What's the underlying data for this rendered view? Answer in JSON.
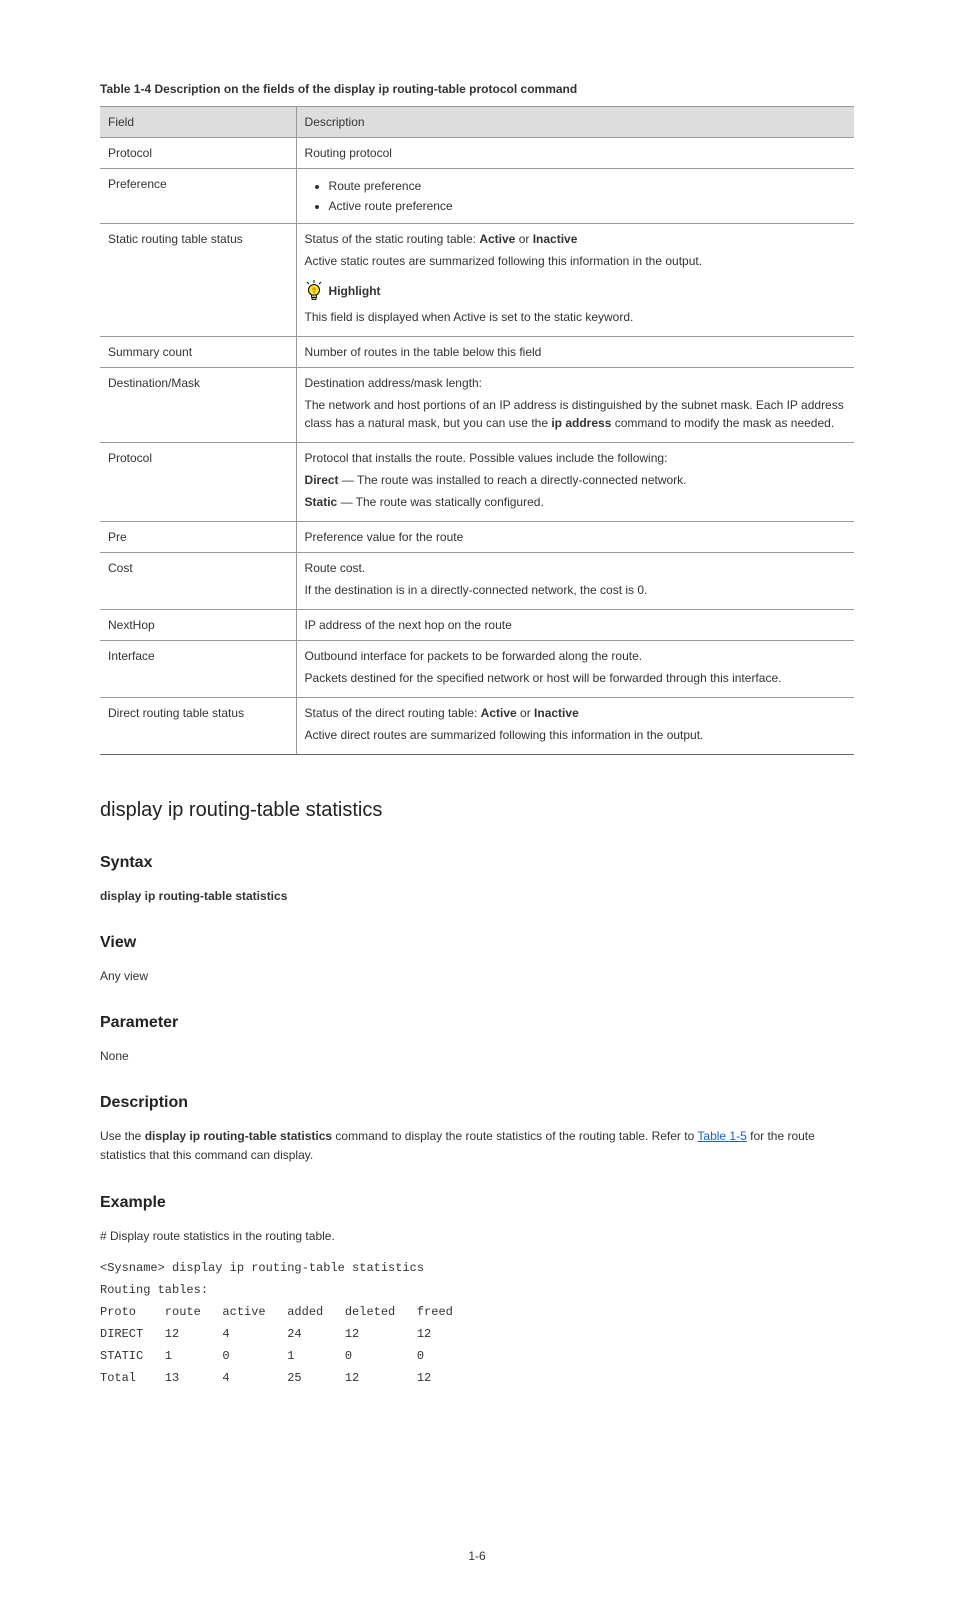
{
  "tableRef": "Table 1-4",
  "tableTitle": "Description on the fields of the",
  "tableTitleCommand": "display ip routing-table protocol",
  "tableTitleSuffix": " command",
  "headers": {
    "field": "Field",
    "description": "Description"
  },
  "rows": {
    "r1": {
      "field": "Protocol",
      "desc": "Routing protocol"
    },
    "r2": {
      "field": "Preference",
      "bullet1": "Route preference",
      "bullet2": "Active route preference"
    },
    "r3": {
      "field": "Static routing table status",
      "line1_a": "Status of the static routing table:",
      "line1_active": "Active",
      "line1_b": " or ",
      "line1_inactive": "Inactive",
      "line2": "Active static routes are summarized following this information in the output.",
      "highlight": "Highlight",
      "highlightText": "This field is displayed when Active is set to the static keyword."
    },
    "r4": {
      "field": "Summary count",
      "desc": "Number of routes in the table below this field"
    },
    "r5": {
      "field": "Destination/Mask",
      "p1": "Destination address/mask length:",
      "p2_a": "The network and host portions of an IP address is distinguished by the subnet mask. Each IP address class has a natural mask, but you can use the ",
      "p2_b": "ip address",
      "p2_c": " command to modify the mask as needed."
    },
    "r6": {
      "field": "Protocol",
      "p1": "Protocol that installs the route. Possible values include the following:",
      "p2_a": "Direct",
      "p2_b": " — The route was installed to reach a directly-connected network.",
      "p3_a": "Static",
      "p3_b": " — The route was statically configured."
    },
    "r7": {
      "field": "Pre",
      "desc": "Preference value for the route"
    },
    "r8": {
      "field": "Cost",
      "p1": "Route cost.",
      "p2": "If the destination is in a directly-connected network, the cost is 0."
    },
    "r9": {
      "field": "NextHop",
      "desc": "IP address of the next hop on the route"
    },
    "r10": {
      "field": "Interface",
      "p1": "Outbound interface for packets to be forwarded along the route.",
      "p2": "Packets destined for the specified network or host will be forwarded through this interface."
    },
    "r11": {
      "field": "Direct routing table status",
      "p1_a": "Status of the direct routing table:",
      "p1_active": "Active",
      "p1_b": " or ",
      "p1_inactive": "Inactive",
      "p2": "Active direct routes are summarized following this information in the output."
    }
  },
  "section1": {
    "title": "display ip routing-table statistics",
    "syntaxLabel": "Syntax",
    "syntaxCmd": "display ip routing-table statistics",
    "viewLabel": "View",
    "viewText": "Any view",
    "paramsLabel": "Parameter",
    "paramsText": "None",
    "descLabel": "Description",
    "desc_a": "Use the ",
    "desc_b": "display ip routing-table statistics",
    "desc_c": " command to display the route statistics of the routing table. Refer to ",
    "desc_link": "Table 1-5",
    "desc_d": " for the route statistics that this command can display."
  },
  "section2": {
    "title": "Example",
    "intro": "# Display route statistics in the routing table.",
    "cmd1_prompt": "<Sysname> ",
    "cmd1": "display ip routing-table statistics",
    "line2": "Routing tables:",
    "line3": "Proto    route   active   added   deleted   freed",
    "line4": "DIRECT   12      4        24      12        12",
    "line5": "STATIC   1       0        1       0         0",
    "line6": "Total    13      4        25      12        12"
  },
  "pageNumber": "1-6"
}
